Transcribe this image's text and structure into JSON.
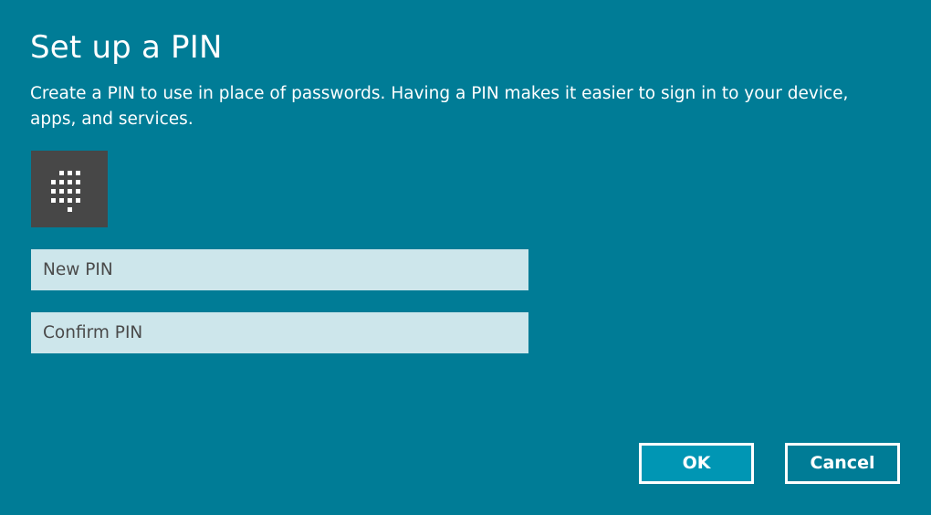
{
  "dialog": {
    "title": "Set up a PIN",
    "description": "Create a PIN to use in place of passwords. Having a PIN makes it easier to sign in to your device, apps, and services.",
    "icon": "keypad-icon"
  },
  "fields": {
    "new_pin_placeholder": "New PIN",
    "confirm_pin_placeholder": "Confirm PIN"
  },
  "buttons": {
    "ok_label": "OK",
    "cancel_label": "Cancel"
  },
  "colors": {
    "background": "#007c96",
    "field_background": "#cde6eb",
    "tile_background": "#474747",
    "ok_background": "#0096b4",
    "button_border": "#ffffff"
  }
}
